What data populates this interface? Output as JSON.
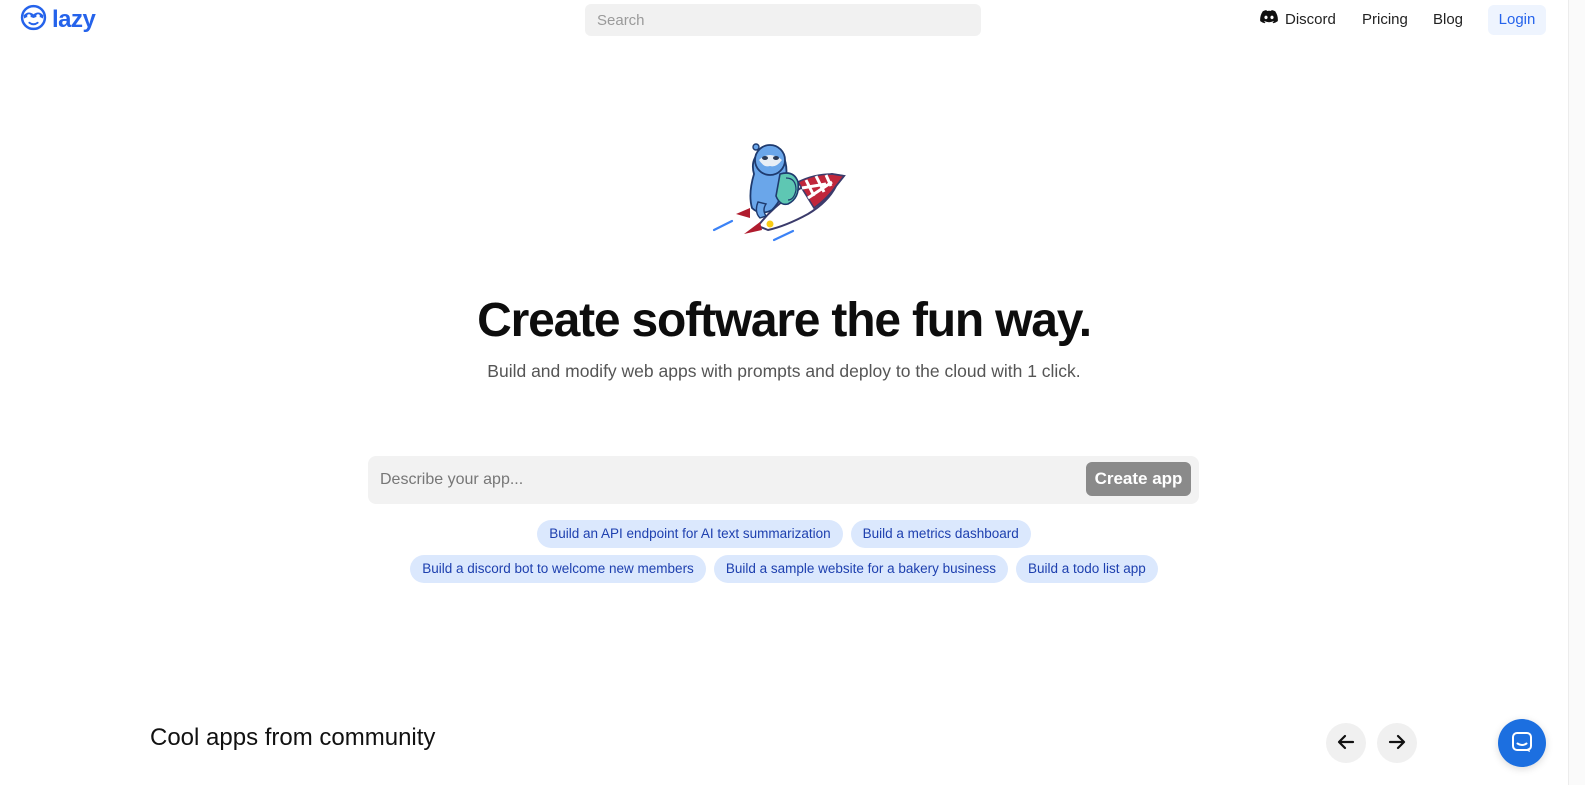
{
  "header": {
    "logo_text": "lazy",
    "search_placeholder": "Search",
    "nav": {
      "discord": "Discord",
      "pricing": "Pricing",
      "blog": "Blog"
    },
    "login_label": "Login"
  },
  "hero": {
    "title": "Create software the fun way.",
    "subtitle": "Build and modify web apps with prompts and deploy to the cloud with 1 click."
  },
  "prompt": {
    "placeholder": "Describe your app...",
    "create_label": "Create app"
  },
  "suggestions": {
    "row1": [
      "Build an API endpoint for AI text summarization",
      "Build a metrics dashboard"
    ],
    "row2": [
      "Build a discord bot to welcome new members",
      "Build a sample website for a bakery business",
      "Build a todo list app"
    ]
  },
  "community": {
    "title": "Cool apps from community"
  },
  "colors": {
    "brand": "#2563eb",
    "chip_bg": "#dbe8fd",
    "chip_text": "#1e40af",
    "create_button": "#8a8a8a",
    "chat_button": "#1c6fe0"
  },
  "icons": {
    "logo": "sloth-face-icon",
    "discord": "discord-icon",
    "arrow_left": "arrow-left-icon",
    "arrow_right": "arrow-right-icon",
    "chat": "chat-icon"
  }
}
